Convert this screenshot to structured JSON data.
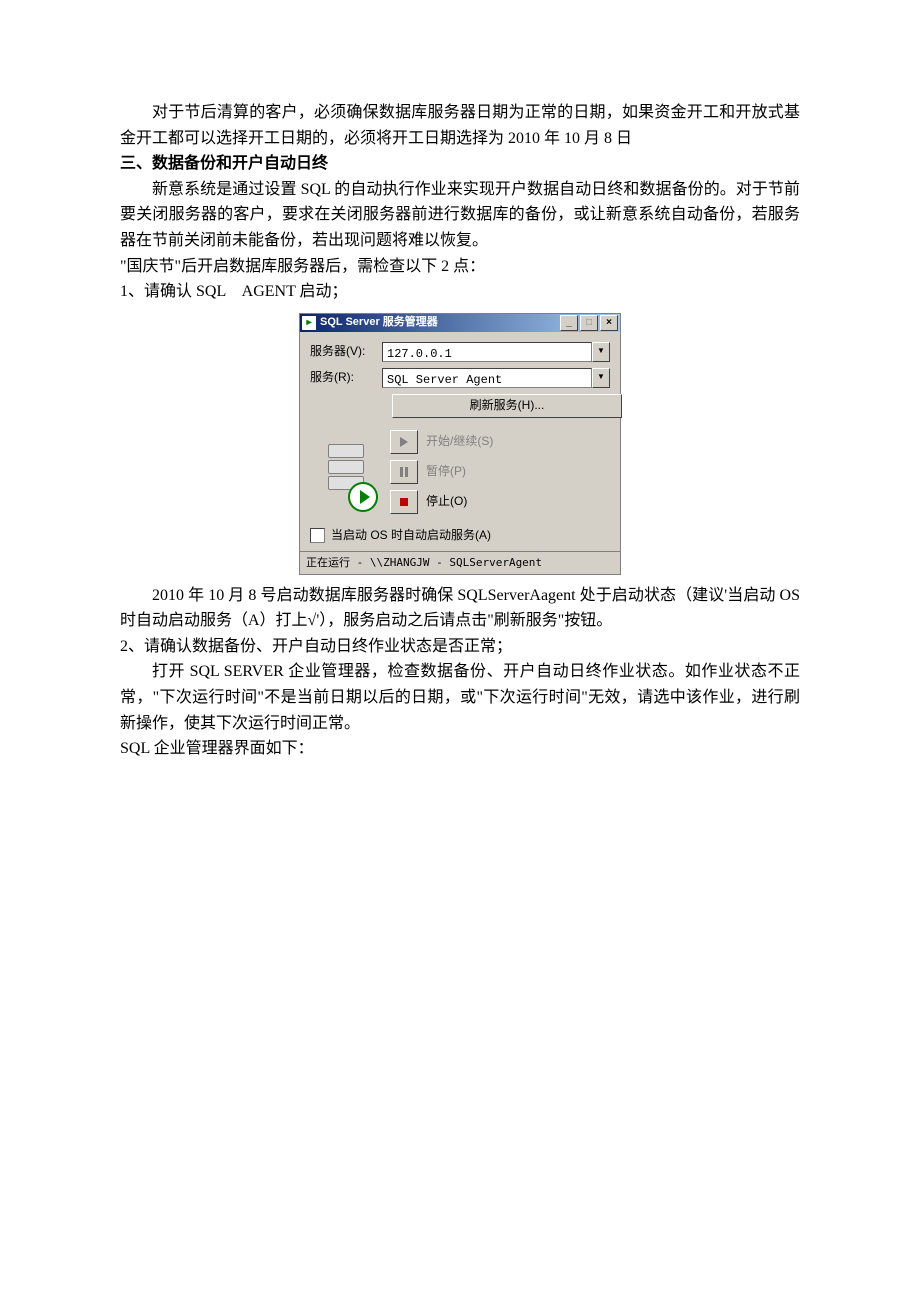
{
  "p1": "对于节后清算的客户，必须确保数据库服务器日期为正常的日期，如果资金开工和开放式基金开工都可以选择开工日期的，必须将开工日期选择为 2010 年 10 月 8 日",
  "h3": "三、数据备份和开户自动日终",
  "p2": "新意系统是通过设置 SQL 的自动执行作业来实现开户数据自动日终和数据备份的。对于节前要关闭服务器的客户，要求在关闭服务器前进行数据库的备份，或让新意系统自动备份，若服务器在节前关闭前未能备份，若出现问题将难以恢复。",
  "p3": "\"国庆节\"后开启数据库服务器后，需检查以下 2 点：",
  "p4": "1、请确认 SQL　AGENT 启动；",
  "dialog": {
    "title": "SQL Server 服务管理器",
    "label_server": "服务器(V):",
    "server_value": "127.0.0.1",
    "label_service": "服务(R):",
    "service_value": "SQL Server Agent",
    "btn_refresh": "刷新服务(H)...",
    "btn_start": "开始/继续(S)",
    "btn_pause": "暂停(P)",
    "btn_stop": "停止(O)",
    "checkbox_label": "当启动 OS 时自动启动服务(A)",
    "status": "正在运行 - \\\\ZHANGJW - SQLServerAgent"
  },
  "p5": "2010 年 10 月 8 号启动数据库服务器时确保 SQLServerAagent 处于启动状态（建议'当启动 OS 时自动启动服务（A）打上√'），服务启动之后请点击\"刷新服务\"按钮。",
  "p6": "2、请确认数据备份、开户自动日终作业状态是否正常；",
  "p7": "打开 SQL SERVER 企业管理器，检查数据备份、开户自动日终作业状态。如作业状态不正常，\"下次运行时间\"不是当前日期以后的日期，或\"下次运行时间\"无效，请选中该作业，进行刷新操作，使其下次运行时间正常。",
  "p8": "SQL 企业管理器界面如下："
}
